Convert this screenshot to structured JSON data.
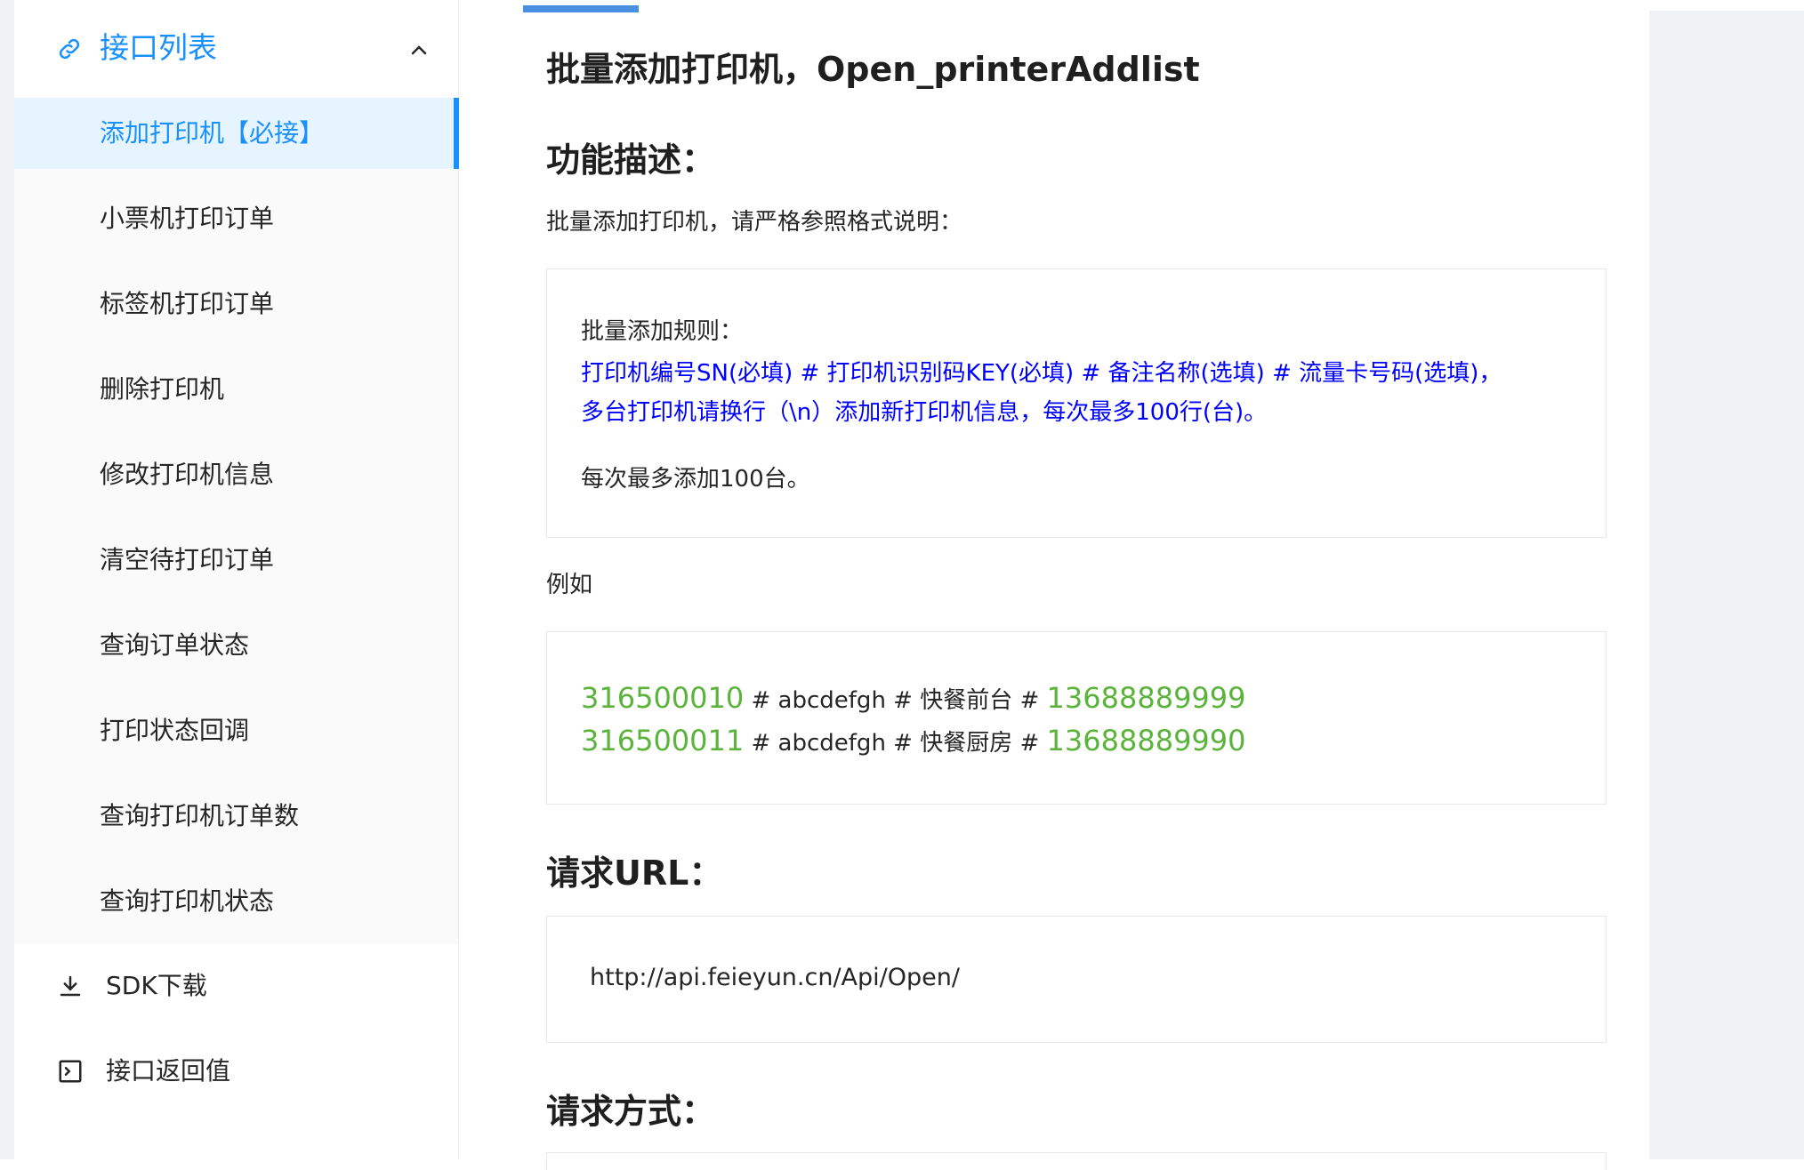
{
  "sidebar": {
    "header_label": "接口列表",
    "items": [
      {
        "label": "添加打印机【必接】",
        "active": true
      },
      {
        "label": "小票机打印订单"
      },
      {
        "label": "标签机打印订单"
      },
      {
        "label": "删除打印机"
      },
      {
        "label": "修改打印机信息"
      },
      {
        "label": "清空待打印订单"
      },
      {
        "label": "查询订单状态"
      },
      {
        "label": "打印状态回调"
      },
      {
        "label": "查询打印机订单数"
      },
      {
        "label": "查询打印机状态"
      }
    ],
    "bottom": [
      {
        "label": "SDK下载",
        "icon": "download-icon"
      },
      {
        "label": "接口返回值",
        "icon": "terminal-icon"
      }
    ]
  },
  "main": {
    "title": "批量添加打印机，Open_printerAddlist",
    "section_function": "功能描述：",
    "function_desc": "批量添加打印机，请严格参照格式说明：",
    "rules": {
      "title": "批量添加规则：",
      "line1": "打印机编号SN(必填) # 打印机识别码KEY(必填) # 备注名称(选填) # 流量卡号码(选填)，",
      "line2": "多台打印机请换行（\\n）添加新打印机信息，每次最多100行(台)。",
      "note": "每次最多添加100台。"
    },
    "example_label": "例如",
    "examples": [
      {
        "sn": "316500010",
        "middle": " # abcdefgh # 快餐前台 # ",
        "phone": "13688889999"
      },
      {
        "sn": "316500011",
        "middle": " # abcdefgh # 快餐厨房 # ",
        "phone": "13688889990"
      }
    ],
    "section_url": "请求URL：",
    "url": "http://api.feieyun.cn/Api/Open/",
    "section_method": "请求方式："
  },
  "colors": {
    "accent": "#1890ff",
    "rule_blue": "#0000ff",
    "example_green": "#5ab43b"
  }
}
